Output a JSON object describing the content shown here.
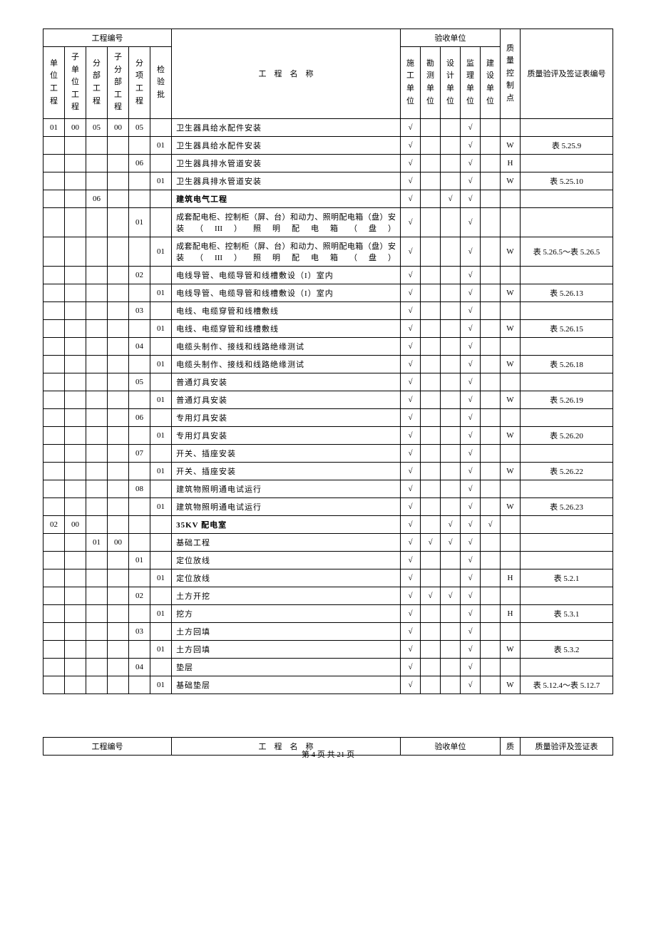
{
  "header_group_proj_num": "工程编号",
  "header_group_accept_unit": "验收单位",
  "hdr_unit_proj": "单位工程",
  "hdr_sub_unit_proj": "子单位工程",
  "hdr_division_proj": "分部工程",
  "hdr_sub_division_proj": "子分部工程",
  "hdr_item_proj": "分项工程",
  "hdr_inspect_batch": "检验批",
  "hdr_proj_name": "工　程　名　称",
  "hdr_construction_unit": "施工单位",
  "hdr_survey_unit": "勘测单位",
  "hdr_design_unit": "设计单位",
  "hdr_supervision_unit": "监理单位",
  "hdr_build_unit": "建设单位",
  "hdr_qc_point": "质量控制点",
  "hdr_quality_form_no": "质量验评及签证表编号",
  "footer_proj_num": "工程编号",
  "footer_proj_name": "工　程　名　称",
  "footer_accept_unit": "验收单位",
  "footer_qc": "质",
  "footer_form_no": "质量验评及签证表",
  "page_num": "第 4 页 共 21 页",
  "check": "√",
  "rows": [
    {
      "c0": "01",
      "c1": "00",
      "c2": "05",
      "c3": "00",
      "c4": "05",
      "c5": "",
      "name": "卫生器具给水配件安装",
      "a0": "√",
      "a1": "",
      "a2": "",
      "a3": "√",
      "a4": "",
      "qc": "",
      "form": ""
    },
    {
      "c0": "",
      "c1": "",
      "c2": "",
      "c3": "",
      "c4": "",
      "c5": "01",
      "name": "卫生器具给水配件安装",
      "a0": "√",
      "a1": "",
      "a2": "",
      "a3": "√",
      "a4": "",
      "qc": "W",
      "form": "表 5.25.9"
    },
    {
      "c0": "",
      "c1": "",
      "c2": "",
      "c3": "",
      "c4": "06",
      "c5": "",
      "name": "卫生器具排水管道安装",
      "a0": "√",
      "a1": "",
      "a2": "",
      "a3": "√",
      "a4": "",
      "qc": "H",
      "form": ""
    },
    {
      "c0": "",
      "c1": "",
      "c2": "",
      "c3": "",
      "c4": "",
      "c5": "01",
      "name": "卫生器具排水管道安装",
      "a0": "√",
      "a1": "",
      "a2": "",
      "a3": "√",
      "a4": "",
      "qc": "W",
      "form": "表 5.25.10"
    },
    {
      "c0": "",
      "c1": "",
      "c2": "06",
      "c3": "",
      "c4": "",
      "c5": "",
      "name": "建筑电气工程",
      "bold": true,
      "a0": "√",
      "a1": "",
      "a2": "√",
      "a3": "√",
      "a4": "",
      "qc": "",
      "form": ""
    },
    {
      "c0": "",
      "c1": "",
      "c2": "",
      "c3": "",
      "c4": "01",
      "c5": "",
      "name": "成套配电柜、控制柜（屏、台）和动力、照明配电箱（盘）安装（III）照明配电箱（盘）",
      "justify": true,
      "a0": "√",
      "a1": "",
      "a2": "",
      "a3": "√",
      "a4": "",
      "qc": "",
      "form": ""
    },
    {
      "c0": "",
      "c1": "",
      "c2": "",
      "c3": "",
      "c4": "",
      "c5": "01",
      "name": "成套配电柜、控制柜（屏、台）和动力、照明配电箱（盘）安装（III）照明配电箱（盘）",
      "justify": true,
      "a0": "√",
      "a1": "",
      "a2": "",
      "a3": "√",
      "a4": "",
      "qc": "W",
      "form": "表 5.26.5～表 5.26.5"
    },
    {
      "c0": "",
      "c1": "",
      "c2": "",
      "c3": "",
      "c4": "02",
      "c5": "",
      "name": "电线导管、电缆导管和线槽敷设（I）室内",
      "a0": "√",
      "a1": "",
      "a2": "",
      "a3": "√",
      "a4": "",
      "qc": "",
      "form": ""
    },
    {
      "c0": "",
      "c1": "",
      "c2": "",
      "c3": "",
      "c4": "",
      "c5": "01",
      "name": "电线导管、电缆导管和线槽敷设（I）室内",
      "a0": "√",
      "a1": "",
      "a2": "",
      "a3": "√",
      "a4": "",
      "qc": "W",
      "form": "表 5.26.13"
    },
    {
      "c0": "",
      "c1": "",
      "c2": "",
      "c3": "",
      "c4": "03",
      "c5": "",
      "name": "电线、电缆穿管和线槽敷线",
      "a0": "√",
      "a1": "",
      "a2": "",
      "a3": "√",
      "a4": "",
      "qc": "",
      "form": ""
    },
    {
      "c0": "",
      "c1": "",
      "c2": "",
      "c3": "",
      "c4": "",
      "c5": "01",
      "name": "电线、电缆穿管和线槽敷线",
      "a0": "√",
      "a1": "",
      "a2": "",
      "a3": "√",
      "a4": "",
      "qc": "W",
      "form": "表 5.26.15"
    },
    {
      "c0": "",
      "c1": "",
      "c2": "",
      "c3": "",
      "c4": "04",
      "c5": "",
      "name": "电缆头制作、接线和线路绝缘测试",
      "a0": "√",
      "a1": "",
      "a2": "",
      "a3": "√",
      "a4": "",
      "qc": "",
      "form": ""
    },
    {
      "c0": "",
      "c1": "",
      "c2": "",
      "c3": "",
      "c4": "",
      "c5": "01",
      "name": "电缆头制作、接线和线路绝缘测试",
      "a0": "√",
      "a1": "",
      "a2": "",
      "a3": "√",
      "a4": "",
      "qc": "W",
      "form": "表 5.26.18"
    },
    {
      "c0": "",
      "c1": "",
      "c2": "",
      "c3": "",
      "c4": "05",
      "c5": "",
      "name": "普通灯具安装",
      "a0": "√",
      "a1": "",
      "a2": "",
      "a3": "√",
      "a4": "",
      "qc": "",
      "form": ""
    },
    {
      "c0": "",
      "c1": "",
      "c2": "",
      "c3": "",
      "c4": "",
      "c5": "01",
      "name": "普通灯具安装",
      "a0": "√",
      "a1": "",
      "a2": "",
      "a3": "√",
      "a4": "",
      "qc": "W",
      "form": "表 5.26.19"
    },
    {
      "c0": "",
      "c1": "",
      "c2": "",
      "c3": "",
      "c4": "06",
      "c5": "",
      "name": "专用灯具安装",
      "a0": "√",
      "a1": "",
      "a2": "",
      "a3": "√",
      "a4": "",
      "qc": "",
      "form": ""
    },
    {
      "c0": "",
      "c1": "",
      "c2": "",
      "c3": "",
      "c4": "",
      "c5": "01",
      "name": "专用灯具安装",
      "a0": "√",
      "a1": "",
      "a2": "",
      "a3": "√",
      "a4": "",
      "qc": "W",
      "form": "表 5.26.20"
    },
    {
      "c0": "",
      "c1": "",
      "c2": "",
      "c3": "",
      "c4": "07",
      "c5": "",
      "name": "开关、插座安装",
      "a0": "√",
      "a1": "",
      "a2": "",
      "a3": "√",
      "a4": "",
      "qc": "",
      "form": ""
    },
    {
      "c0": "",
      "c1": "",
      "c2": "",
      "c3": "",
      "c4": "",
      "c5": "01",
      "name": "开关、插座安装",
      "a0": "√",
      "a1": "",
      "a2": "",
      "a3": "√",
      "a4": "",
      "qc": "W",
      "form": "表 5.26.22"
    },
    {
      "c0": "",
      "c1": "",
      "c2": "",
      "c3": "",
      "c4": "08",
      "c5": "",
      "name": "建筑物照明通电试运行",
      "a0": "√",
      "a1": "",
      "a2": "",
      "a3": "√",
      "a4": "",
      "qc": "",
      "form": ""
    },
    {
      "c0": "",
      "c1": "",
      "c2": "",
      "c3": "",
      "c4": "",
      "c5": "01",
      "name": "建筑物照明通电试运行",
      "a0": "√",
      "a1": "",
      "a2": "",
      "a3": "√",
      "a4": "",
      "qc": "W",
      "form": "表 5.26.23"
    },
    {
      "c0": "02",
      "c1": "00",
      "c2": "",
      "c3": "",
      "c4": "",
      "c5": "",
      "name": "35KV 配电室",
      "bold": true,
      "a0": "√",
      "a1": "",
      "a2": "√",
      "a3": "√",
      "a4": "√",
      "qc": "",
      "form": ""
    },
    {
      "c0": "",
      "c1": "",
      "c2": "01",
      "c3": "00",
      "c4": "",
      "c5": "",
      "name": "基础工程",
      "a0": "√",
      "a1": "√",
      "a2": "√",
      "a3": "√",
      "a4": "",
      "qc": "",
      "form": ""
    },
    {
      "c0": "",
      "c1": "",
      "c2": "",
      "c3": "",
      "c4": "01",
      "c5": "",
      "name": "定位放线",
      "a0": "√",
      "a1": "",
      "a2": "",
      "a3": "√",
      "a4": "",
      "qc": "",
      "form": ""
    },
    {
      "c0": "",
      "c1": "",
      "c2": "",
      "c3": "",
      "c4": "",
      "c5": "01",
      "name": "定位放线",
      "a0": "√",
      "a1": "",
      "a2": "",
      "a3": "√",
      "a4": "",
      "qc": "H",
      "form": "表 5.2.1"
    },
    {
      "c0": "",
      "c1": "",
      "c2": "",
      "c3": "",
      "c4": "02",
      "c5": "",
      "name": "土方开挖",
      "a0": "√",
      "a1": "√",
      "a2": "√",
      "a3": "√",
      "a4": "",
      "qc": "",
      "form": ""
    },
    {
      "c0": "",
      "c1": "",
      "c2": "",
      "c3": "",
      "c4": "",
      "c5": "01",
      "name": "挖方",
      "a0": "√",
      "a1": "",
      "a2": "",
      "a3": "√",
      "a4": "",
      "qc": "H",
      "form": "表 5.3.1"
    },
    {
      "c0": "",
      "c1": "",
      "c2": "",
      "c3": "",
      "c4": "03",
      "c5": "",
      "name": "土方回填",
      "a0": "√",
      "a1": "",
      "a2": "",
      "a3": "√",
      "a4": "",
      "qc": "",
      "form": ""
    },
    {
      "c0": "",
      "c1": "",
      "c2": "",
      "c3": "",
      "c4": "",
      "c5": "01",
      "name": "土方回填",
      "a0": "√",
      "a1": "",
      "a2": "",
      "a3": "√",
      "a4": "",
      "qc": "W",
      "form": "表 5.3.2"
    },
    {
      "c0": "",
      "c1": "",
      "c2": "",
      "c3": "",
      "c4": "04",
      "c5": "",
      "name": "垫层",
      "a0": "√",
      "a1": "",
      "a2": "",
      "a3": "√",
      "a4": "",
      "qc": "",
      "form": ""
    },
    {
      "c0": "",
      "c1": "",
      "c2": "",
      "c3": "",
      "c4": "",
      "c5": "01",
      "name": "基础垫层",
      "a0": "√",
      "a1": "",
      "a2": "",
      "a3": "√",
      "a4": "",
      "qc": "W",
      "form": "表 5.12.4～表 5.12.7"
    }
  ]
}
